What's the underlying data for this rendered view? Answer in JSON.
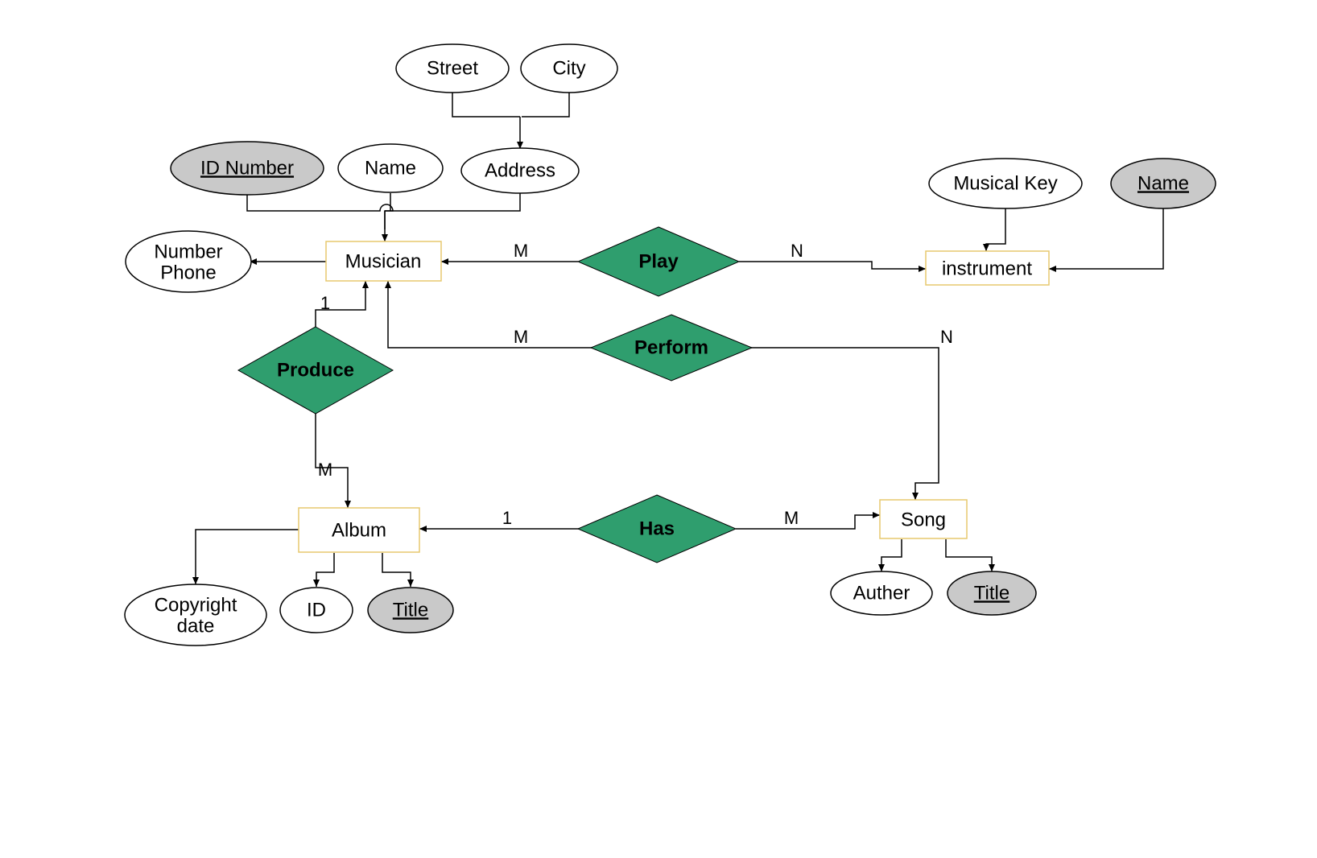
{
  "entities": {
    "musician": "Musician",
    "instrument": "instrument",
    "album": "Album",
    "song": "Song"
  },
  "relationships": {
    "play": "Play",
    "perform": "Perform",
    "produce": "Produce",
    "has": "Has"
  },
  "attributes": {
    "street": "Street",
    "city": "City",
    "address": "Address",
    "id_number": "ID Number",
    "name": "Name",
    "number_phone_l1": "Number",
    "number_phone_l2": "Phone",
    "musical_key": "Musical Key",
    "instrument_name": "Name",
    "copyright_l1": "Copyright",
    "copyright_l2": "date",
    "album_id": "ID",
    "album_title": "Title",
    "song_author": "Auther",
    "song_title": "Title"
  },
  "cardinalities": {
    "play_musician": "M",
    "play_instrument": "N",
    "perform_musician": "M",
    "perform_song": "N",
    "produce_musician": "1",
    "produce_album": "M",
    "has_album": "1",
    "has_song": "M"
  },
  "colors": {
    "entity_border": "#e7c96f",
    "relationship_fill": "#2f9e6e",
    "key_attribute_fill": "#c9c9c9"
  }
}
